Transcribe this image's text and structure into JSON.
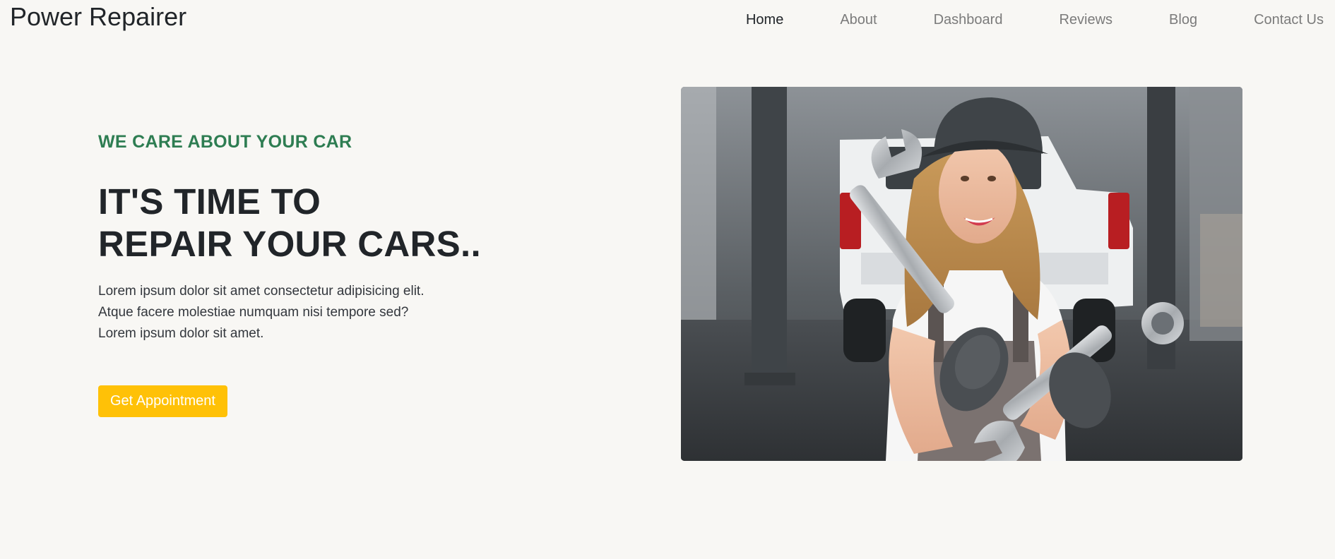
{
  "brand": {
    "name": "Power Repairer"
  },
  "nav": {
    "items": [
      {
        "label": "Home",
        "active": true
      },
      {
        "label": "About",
        "active": false
      },
      {
        "label": "Dashboard",
        "active": false
      },
      {
        "label": "Reviews",
        "active": false
      },
      {
        "label": "Blog",
        "active": false
      },
      {
        "label": "Contact Us",
        "active": false
      }
    ]
  },
  "hero": {
    "eyebrow": "WE CARE ABOUT YOUR CAR",
    "headline_line1": "IT'S TIME TO",
    "headline_line2": "REPAIR YOUR CARS..",
    "body": "Lorem ipsum dolor sit amet consectetur adipisicing elit. Atque facere molestiae numquam nisi tempore sed? Lorem ipsum dolor sit amet.",
    "cta_label": "Get Appointment",
    "image_alt_subject": "mechanic-holding-wrenches"
  },
  "colors": {
    "background": "#f8f7f4",
    "accent_green": "#2e7d52",
    "cta_yellow": "#ffc107",
    "text_dark": "#212529",
    "nav_muted": "#7b7b7b"
  }
}
